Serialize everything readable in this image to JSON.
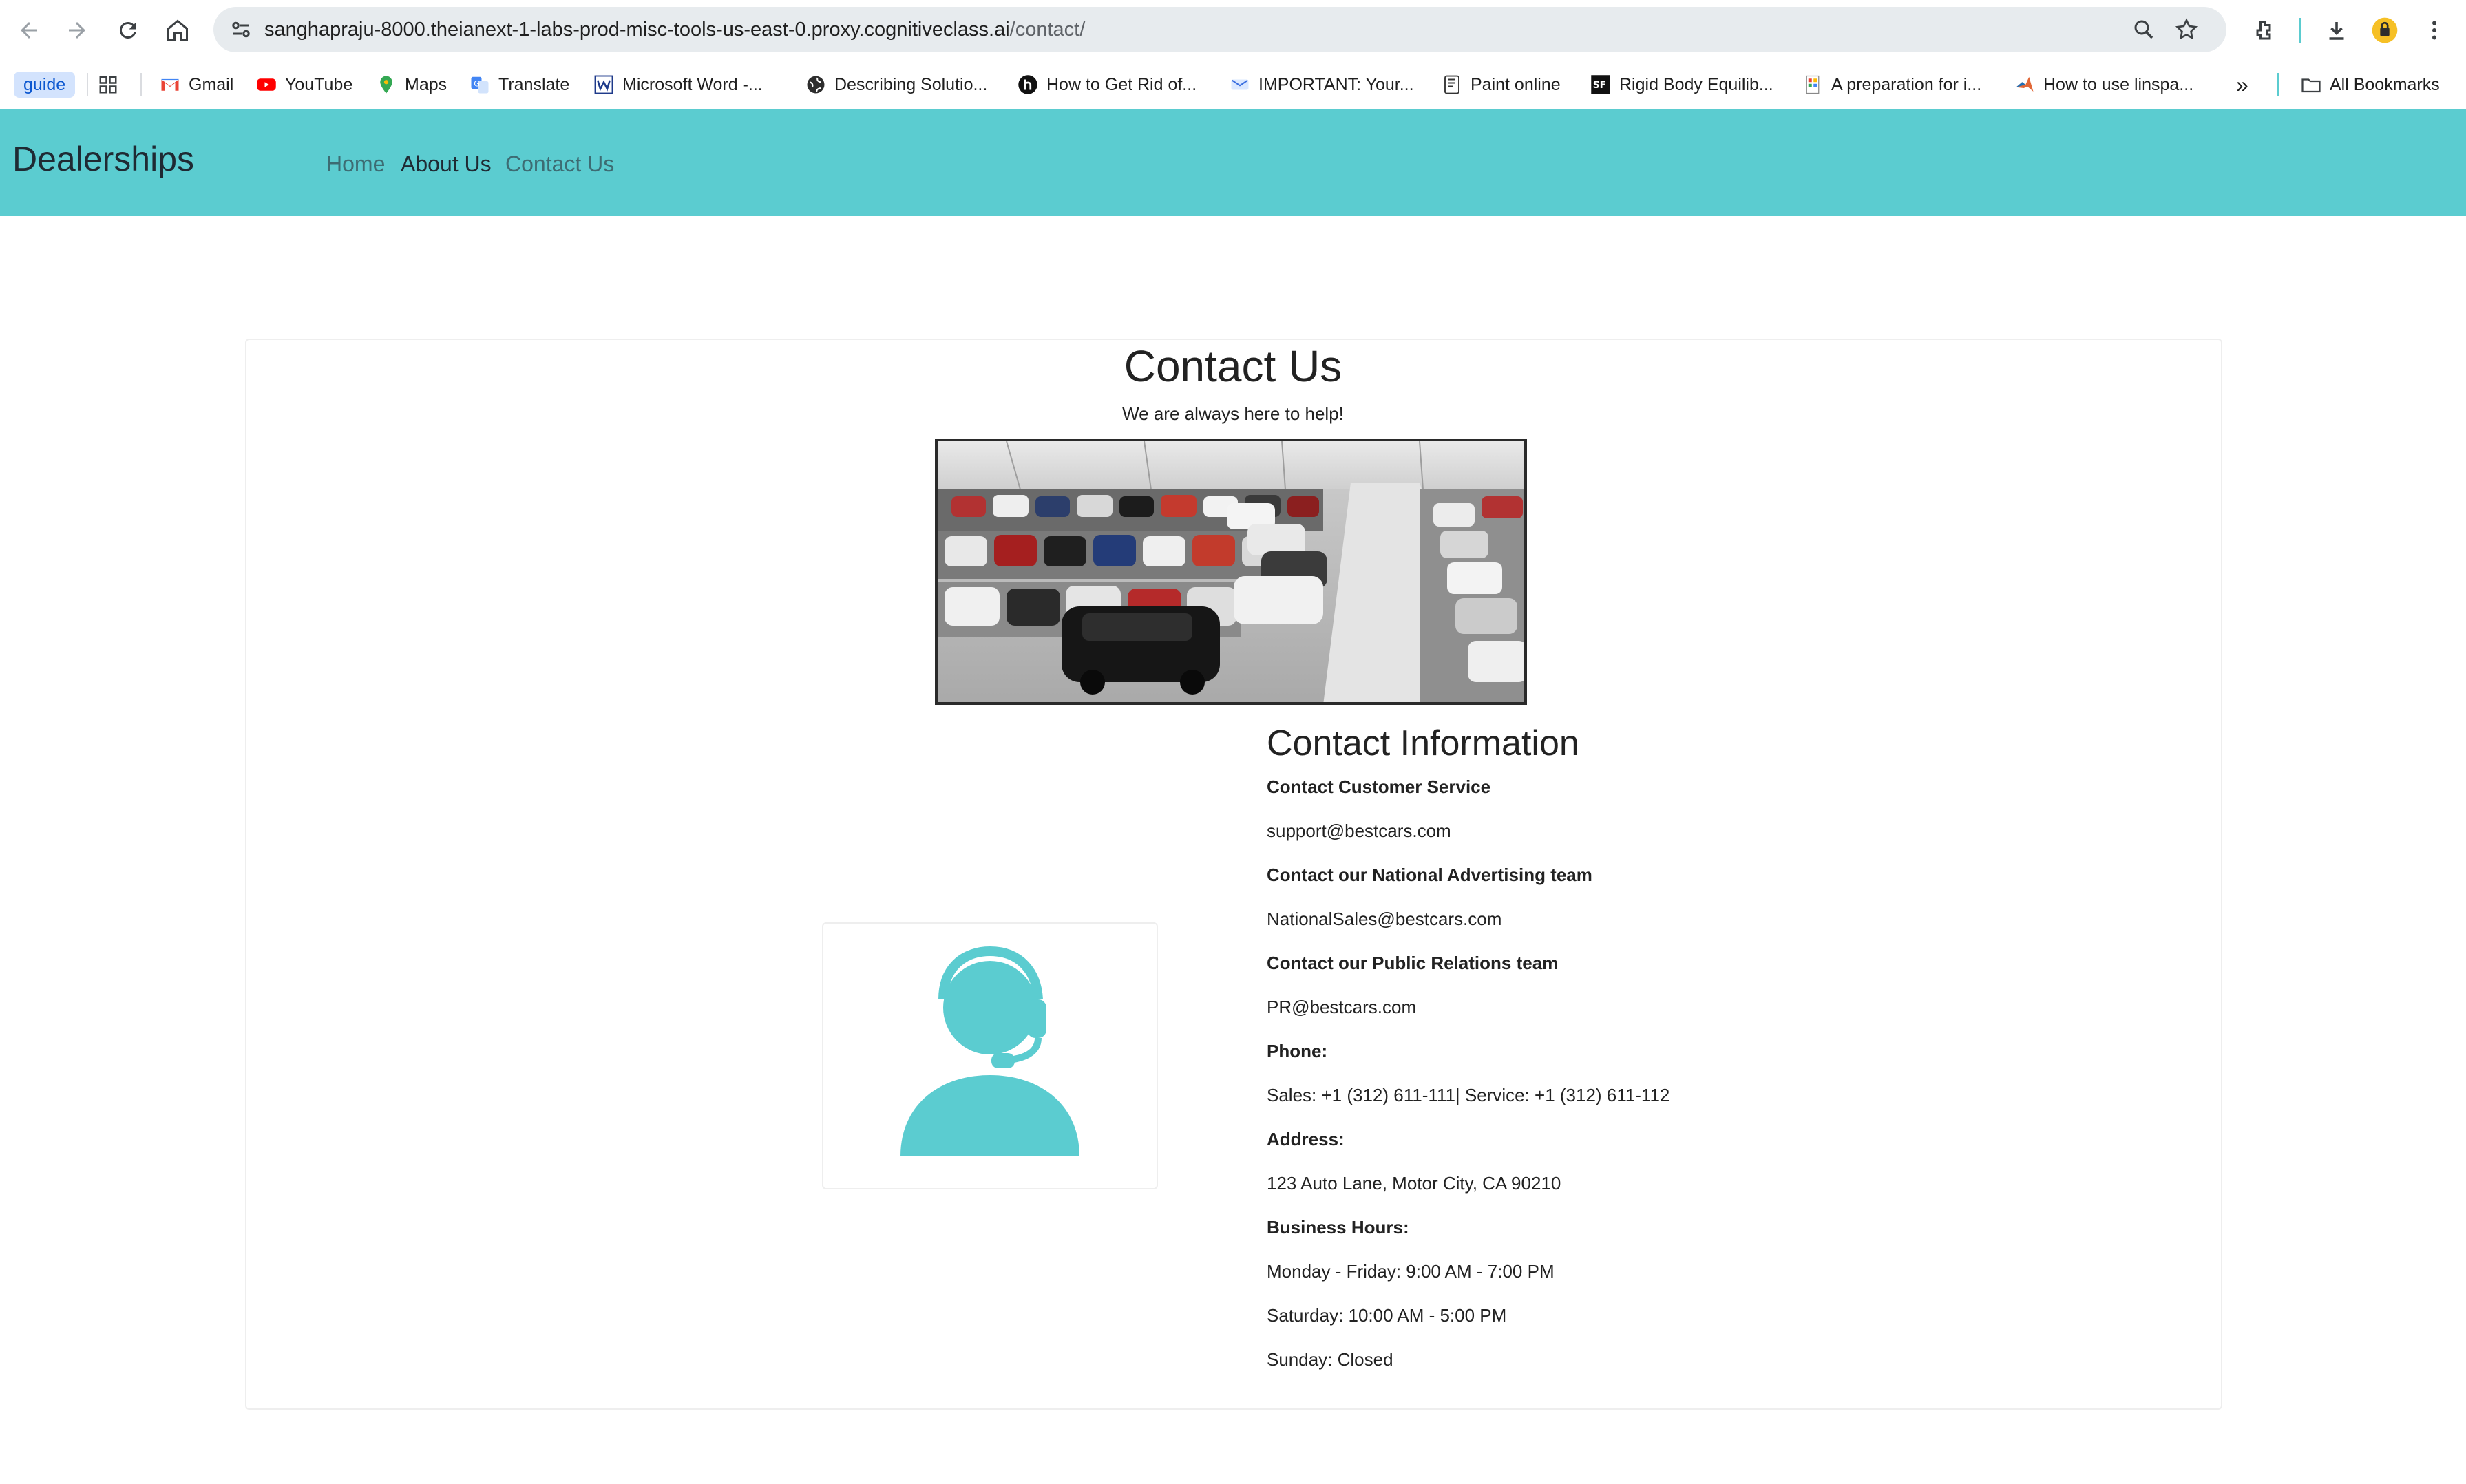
{
  "browser": {
    "url_host": "sanghapraju-8000.theianext-1-labs-prod-misc-tools-us-east-0.proxy.cognitiveclass.ai",
    "url_path": "/contact/",
    "bookmarks": {
      "guide": "guide",
      "gmail": "Gmail",
      "youtube": "YouTube",
      "maps": "Maps",
      "translate": "Translate",
      "word": "Microsoft Word -...",
      "describing": "Describing Solutio...",
      "howto": "How to Get Rid of...",
      "important": "IMPORTANT: Your...",
      "paint": "Paint online",
      "rigid": "Rigid Body Equilib...",
      "prep": "A preparation for i...",
      "linspace": "How to use linspa...",
      "more": "»",
      "all": "All Bookmarks"
    }
  },
  "navbar": {
    "brand": "Dealerships",
    "links": {
      "home": "Home",
      "about": "About Us",
      "contact": "Contact Us"
    },
    "colors": {
      "bar": "#5bccd0",
      "link": "#3d6c73",
      "active": "#1f2a33"
    }
  },
  "main": {
    "title": "Contact Us",
    "subtitle": "We are always here to help!",
    "info": {
      "title": "Contact Information",
      "customer_service_label": "Contact Customer Service",
      "customer_service_email": "support@bestcars.com",
      "advertising_label": "Contact our National Advertising team",
      "advertising_email": "NationalSales@bestcars.com",
      "pr_label": "Contact our Public Relations team",
      "pr_email": "PR@bestcars.com",
      "phone_label": "Phone:",
      "phone_value": "Sales: +1 (312) 611-111| Service: +1 (312) 611-112",
      "address_label": "Address:",
      "address_value": "123 Auto Lane, Motor City, CA 90210",
      "hours_label": "Business Hours:",
      "hours_weekday": "Monday - Friday: 9:00 AM - 7:00 PM",
      "hours_saturday": "Saturday: 10:00 AM - 5:00 PM",
      "hours_sunday": "Sunday: Closed"
    },
    "icon_color": "#5bccd0"
  }
}
